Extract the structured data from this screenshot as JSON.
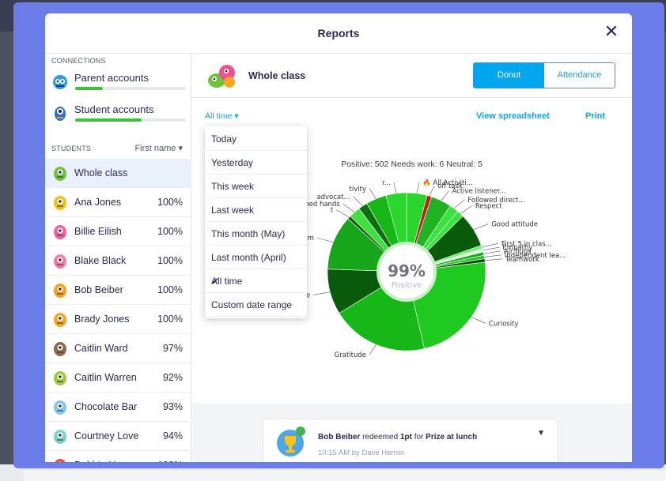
{
  "modal": {
    "title": "Reports",
    "close": "✕"
  },
  "sidebar": {
    "connections_label": "CONNECTIONS",
    "connections": [
      {
        "label": "Parent accounts",
        "progress": 0.25
      },
      {
        "label": "Student accounts",
        "progress": 0.6
      }
    ],
    "students_label": "STUDENTS",
    "sort_label": "First name ▾",
    "students": [
      {
        "name": "Whole class",
        "percent": "",
        "selected": true,
        "color": "#6dc33a"
      },
      {
        "name": "Ana Jones",
        "percent": "100%",
        "color": "#f2c21c"
      },
      {
        "name": "Billie Eilish",
        "percent": "100%",
        "color": "#f05fa0"
      },
      {
        "name": "Blake Black",
        "percent": "100%",
        "color": "#f27aa8"
      },
      {
        "name": "Bob Beiber",
        "percent": "100%",
        "color": "#f6a21d"
      },
      {
        "name": "Brady Jones",
        "percent": "100%",
        "color": "#f5a623"
      },
      {
        "name": "Caitlin Ward",
        "percent": "97%",
        "color": "#8c6a4a"
      },
      {
        "name": "Caitlin Warren",
        "percent": "92%",
        "color": "#9ccc40"
      },
      {
        "name": "Chocolate Bar",
        "percent": "93%",
        "color": "#7fc8e8"
      },
      {
        "name": "Courtney Love",
        "percent": "94%",
        "color": "#79d3c7"
      },
      {
        "name": "Debbie Harry",
        "percent": "100%",
        "color": "#e8503a"
      }
    ]
  },
  "main": {
    "class_name": "Whole class",
    "view_toggle": {
      "active": "Donut",
      "inactive": "Attendance"
    },
    "range_label": "All time ▾",
    "view_spreadsheet": "View spreadsheet",
    "print": "Print",
    "stats": "Positive: 502   Needs work: 6   Neutral: 5"
  },
  "date_menu": {
    "items": [
      "Today",
      "Yesterday",
      "This week",
      "Last week",
      "This month (May)",
      "Last month (April)",
      "All time",
      "Custom date range"
    ],
    "selected_index": 6,
    "check": "✔"
  },
  "feed": {
    "student": "Bob Beiber",
    "mid": " redeemed ",
    "points": "1pt",
    "for": " for ",
    "prize": "Prize at lunch",
    "meta": "10:15 AM by Dave Herron",
    "badge": "1"
  },
  "chart_data": {
    "type": "pie",
    "center_value": "99%",
    "center_label": "Positive",
    "labels": [
      "🔥 All Activiti...",
      "off task",
      "Active listener...",
      "Followed direct...",
      "Respect",
      "Good attitude",
      "First 5 in clas...",
      "Empathy",
      "Air hugs",
      "Independent lea...",
      "Teamwork",
      "Curiosity",
      "Gratitude",
      "Persistence",
      "Optimism",
      "t",
      "Washed hands",
      "advocat...",
      "tivity",
      "r..."
    ],
    "values": [
      18,
      4,
      18,
      8,
      6,
      30,
      3,
      3,
      3,
      3,
      3,
      100,
      85,
      40,
      48,
      3,
      10,
      8,
      18,
      18
    ],
    "colors": [
      "#27d72a",
      "#c6191c",
      "#1fb321",
      "#39e23c",
      "#39e23c",
      "#0a5a0c",
      "#6fef71",
      "#d9f7d9",
      "#1fa821",
      "#23c426",
      "#0e4b10",
      "#1fca20",
      "#16b818",
      "#0a5a0c",
      "#17a519",
      "#0a5a0c",
      "#40e03f",
      "#0e6e10",
      "#16b818",
      "#2bd62d"
    ]
  }
}
